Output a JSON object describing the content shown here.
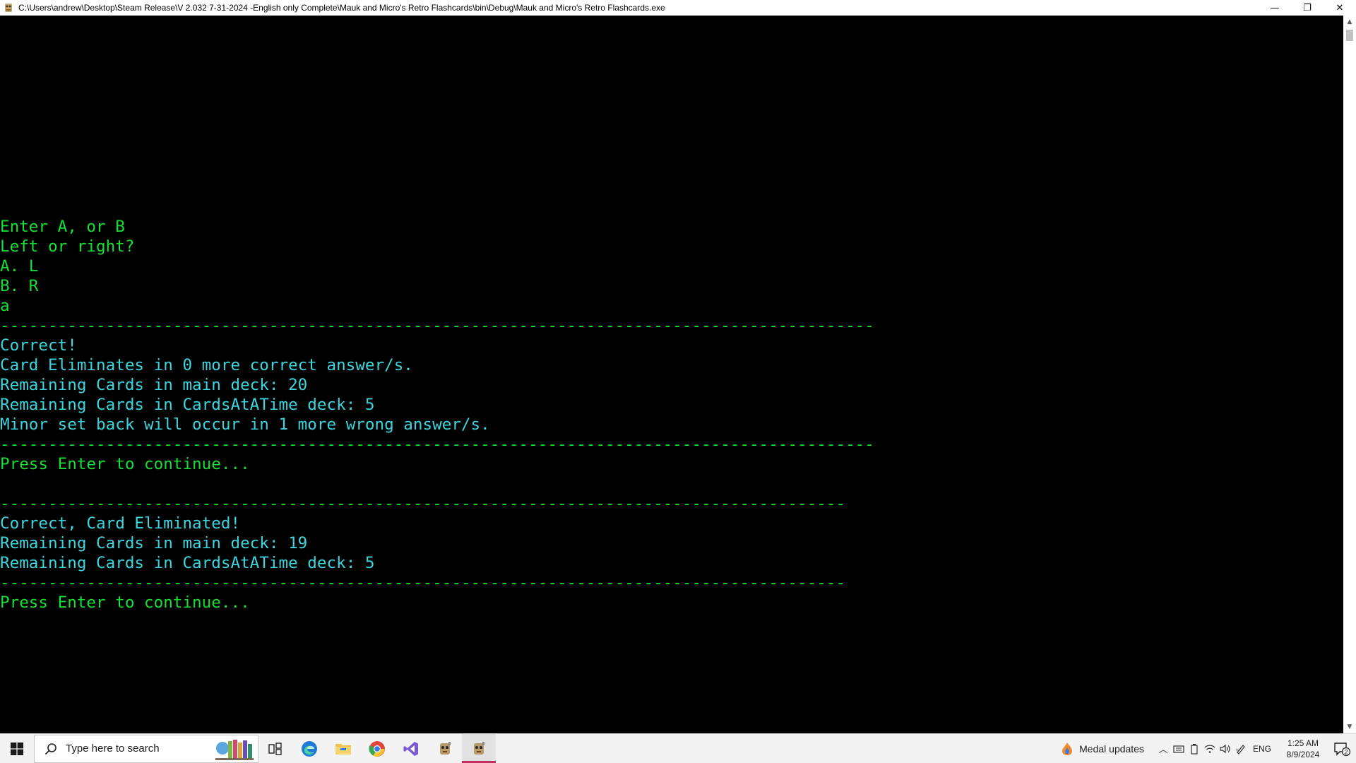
{
  "window": {
    "title": "C:\\Users\\andrew\\Desktop\\Steam Release\\V 2.032 7-31-2024 -English only Complete\\Mauk and Micro's Retro Flashcards\\bin\\Debug\\Mauk and Micro's Retro Flashcards.exe",
    "minimize_glyph": "—",
    "restore_glyph": "❐",
    "close_glyph": "✕"
  },
  "console": {
    "colors": {
      "green": "#13e033",
      "cyan": "#3ad6e0",
      "background": "#000000"
    },
    "lines": [
      {
        "text": "Enter A, or B",
        "color": "green"
      },
      {
        "text": "Left or right?",
        "color": "green"
      },
      {
        "text": "A. L",
        "color": "green"
      },
      {
        "text": "B. R",
        "color": "green"
      },
      {
        "text": "a",
        "color": "green"
      },
      {
        "text": "-------------------------------------------------------------------------------------------",
        "color": "green"
      },
      {
        "text": "Correct!",
        "color": "cyan"
      },
      {
        "text": "Card Eliminates in 0 more correct answer/s.",
        "color": "cyan"
      },
      {
        "text": "Remaining Cards in main deck: 20",
        "color": "cyan"
      },
      {
        "text": "Remaining Cards in CardsAtATime deck: 5",
        "color": "cyan"
      },
      {
        "text": "Minor set back will occur in 1 more wrong answer/s.",
        "color": "cyan"
      },
      {
        "text": "-------------------------------------------------------------------------------------------",
        "color": "green"
      },
      {
        "text": "Press Enter to continue...",
        "color": "green"
      },
      {
        "text": "",
        "color": "green"
      },
      {
        "text": "----------------------------------------------------------------------------------------",
        "color": "green"
      },
      {
        "text": "Correct, Card Eliminated!",
        "color": "cyan"
      },
      {
        "text": "Remaining Cards in main deck: 19",
        "color": "cyan"
      },
      {
        "text": "Remaining Cards in CardsAtATime deck: 5",
        "color": "cyan"
      },
      {
        "text": "----------------------------------------------------------------------------------------",
        "color": "green"
      },
      {
        "text": "Press Enter to continue...",
        "color": "green"
      }
    ]
  },
  "taskbar": {
    "search_placeholder": "Type here to search",
    "pinned": [
      {
        "name": "task-view-icon"
      },
      {
        "name": "edge-icon"
      },
      {
        "name": "file-explorer-icon"
      },
      {
        "name": "chrome-icon"
      },
      {
        "name": "visual-studio-icon"
      },
      {
        "name": "flashcards-app-icon"
      },
      {
        "name": "flashcards-app-running-icon",
        "active": true
      }
    ],
    "medal_label": "Medal updates",
    "language": "ENG",
    "time": "1:25 AM",
    "date": "8/9/2024",
    "notification_count": "2"
  }
}
